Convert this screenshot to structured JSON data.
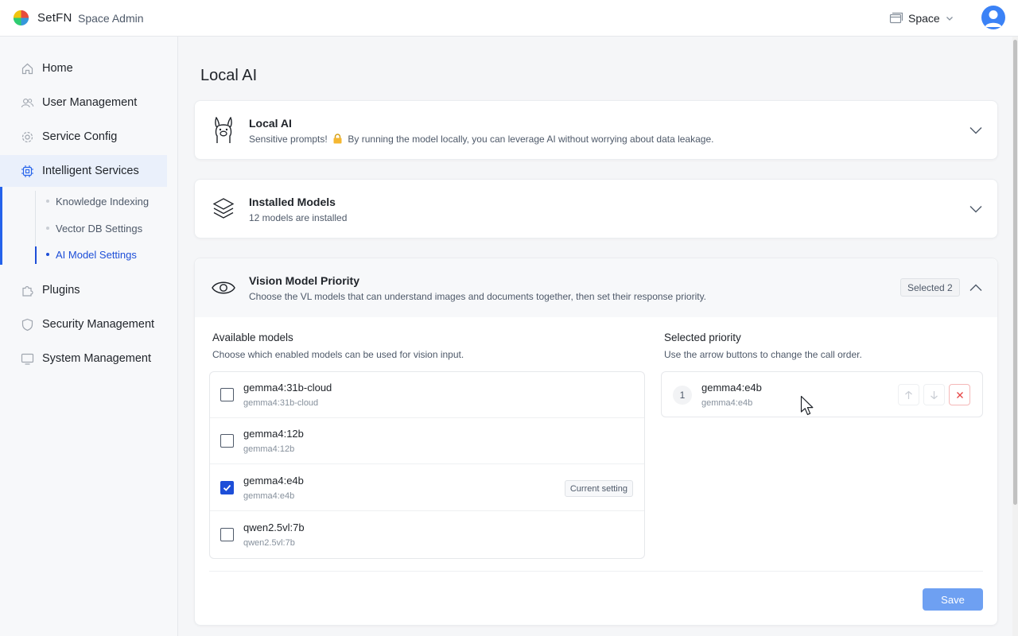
{
  "header": {
    "brand": "SetFN",
    "subtitle": "Space Admin",
    "space_label": "Space"
  },
  "sidebar": {
    "items": [
      {
        "label": "Home"
      },
      {
        "label": "User Management"
      },
      {
        "label": "Service Config"
      },
      {
        "label": "Intelligent Services"
      },
      {
        "label": "Plugins"
      },
      {
        "label": "Security Management"
      },
      {
        "label": "System Management"
      }
    ],
    "sub_items": [
      {
        "label": "Knowledge Indexing"
      },
      {
        "label": "Vector DB Settings"
      },
      {
        "label": "AI Model Settings"
      }
    ]
  },
  "page": {
    "title": "Local AI"
  },
  "local_ai_card": {
    "title": "Local AI",
    "desc_prefix": "Sensitive prompts!",
    "desc_suffix": "By running the model locally, you can leverage AI without worrying about data leakage."
  },
  "installed_card": {
    "title": "Installed Models",
    "desc": "12 models are installed"
  },
  "vision_card": {
    "title": "Vision Model Priority",
    "desc": "Choose the VL models that can understand images and documents together, then set their response priority.",
    "badge": "Selected 2",
    "available": {
      "title": "Available models",
      "desc": "Choose which enabled models can be used for vision input.",
      "models": [
        {
          "name": "gemma4:31b-cloud",
          "id": "gemma4:31b-cloud",
          "checked": false
        },
        {
          "name": "gemma4:12b",
          "id": "gemma4:12b",
          "checked": false
        },
        {
          "name": "gemma4:e4b",
          "id": "gemma4:e4b",
          "checked": true,
          "tag": "Current setting"
        },
        {
          "name": "qwen2.5vl:7b",
          "id": "qwen2.5vl:7b",
          "checked": false
        }
      ]
    },
    "priority": {
      "title": "Selected priority",
      "desc": "Use the arrow buttons to change the call order.",
      "items": [
        {
          "rank": "1",
          "name": "gemma4:e4b",
          "id": "gemma4:e4b"
        }
      ]
    },
    "save_label": "Save"
  },
  "colors": {
    "accent": "#1d4ed8",
    "save": "#6ea0f2",
    "danger": "#e54545"
  }
}
